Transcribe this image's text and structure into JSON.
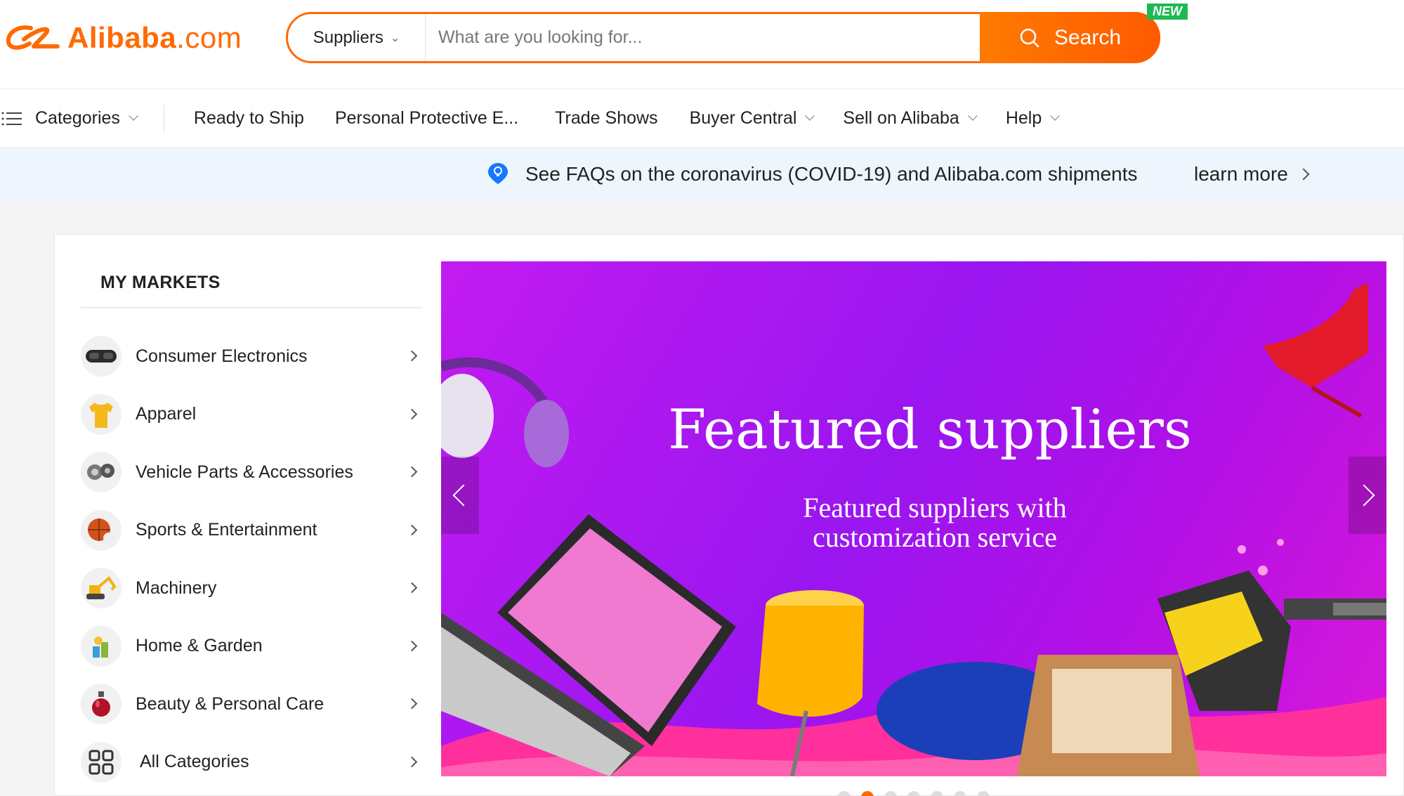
{
  "header": {
    "logo_text": "Alibaba",
    "logo_suffix": ".com",
    "search_type": "Suppliers",
    "search_placeholder": "What are you looking for...",
    "search_button": "Search",
    "new_badge": "NEW"
  },
  "nav": {
    "categories": "Categories",
    "items": [
      {
        "label": "Ready to Ship",
        "dropdown": false
      },
      {
        "label": "Personal Protective E...",
        "dropdown": false
      },
      {
        "label": "Trade Shows",
        "dropdown": false
      },
      {
        "label": "Buyer Central",
        "dropdown": true
      },
      {
        "label": "Sell on Alibaba",
        "dropdown": true
      },
      {
        "label": "Help",
        "dropdown": true
      }
    ]
  },
  "notice": {
    "text": "See FAQs on the coronavirus (COVID-19) and Alibaba.com shipments",
    "link": "learn more"
  },
  "markets": {
    "title": "MY MARKETS",
    "items": [
      {
        "label": "Consumer Electronics",
        "icon": "vr-headset-icon"
      },
      {
        "label": "Apparel",
        "icon": "tshirt-icon"
      },
      {
        "label": "Vehicle Parts & Accessories",
        "icon": "car-parts-icon"
      },
      {
        "label": "Sports & Entertainment",
        "icon": "basketball-icon"
      },
      {
        "label": "Machinery",
        "icon": "excavator-icon"
      },
      {
        "label": "Home & Garden",
        "icon": "home-goods-icon"
      },
      {
        "label": "Beauty & Personal Care",
        "icon": "perfume-icon"
      },
      {
        "label": "All Categories",
        "icon": "grid-icon"
      }
    ]
  },
  "banner": {
    "title": "Featured suppliers",
    "subtitle_line1": "Featured suppliers with",
    "subtitle_line2": "customization service",
    "slides": 7,
    "active_slide": 2
  },
  "colors": {
    "brand": "#ff6a00",
    "new_badge": "#1db954",
    "notice_bg": "#eef5fd"
  }
}
